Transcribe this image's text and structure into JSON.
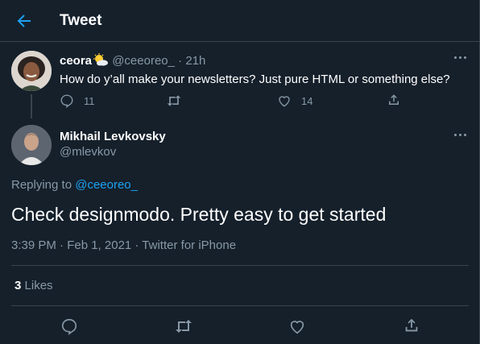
{
  "header": {
    "title": "Tweet"
  },
  "parent_tweet": {
    "name": "ceora",
    "handle": "@ceeoreo_",
    "separator": "·",
    "time": "21h",
    "text": "How do y’all make your newsletters? Just pure HTML or something else?",
    "reply_count": "11",
    "like_count": "14"
  },
  "main_tweet": {
    "name": "Mikhail Levkovsky",
    "handle": "@mlevkov",
    "replying_prefix": "Replying to",
    "replying_to": "@ceeoreo_",
    "text": "Check designmodo. Pretty easy to get started",
    "meta": "3:39 PM · Feb 1, 2021 · Twitter for iPhone",
    "likes_count": "3",
    "likes_label": "Likes"
  },
  "colors": {
    "background": "#15202b",
    "border": "#38444d",
    "muted": "#8899a6",
    "accent": "#1da1f2"
  },
  "icons": [
    "back-arrow-icon",
    "more-icon",
    "reply-icon",
    "retweet-icon",
    "like-icon",
    "share-icon",
    "sun-cloud-emoji"
  ]
}
